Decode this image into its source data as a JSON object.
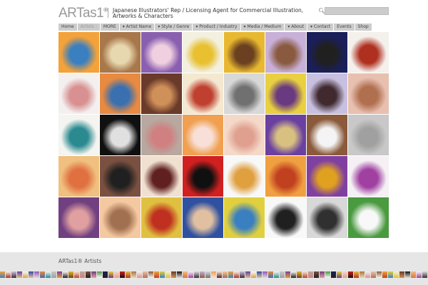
{
  "header": {
    "logo": "ARTas1",
    "logo_mark": "®",
    "tagline": "Japanese Illustrators' Rep / Licensing Agent for Commercial Illustration, Artworks & Characters",
    "search_placeholder": ""
  },
  "nav": [
    {
      "label": "Home"
    },
    {
      "label": "Artists :",
      "dim": true
    },
    {
      "label": "MORE"
    },
    {
      "label": "▾ Artist Name"
    },
    {
      "label": "▾ Style / Genre"
    },
    {
      "label": "▾ Product / Industry"
    },
    {
      "label": "▾ Media / Medium"
    },
    {
      "label": "▾ About"
    },
    {
      "label": "▾ Contact"
    },
    {
      "label": "Events"
    },
    {
      "label": "Shop"
    }
  ],
  "tiles": [
    [
      "#f4a23a",
      "#3a7fc0"
    ],
    [
      "#a8774a",
      "#e8d8b0"
    ],
    [
      "#8a5fb0",
      "#f0d0e0"
    ],
    [
      "#f3f0e0",
      "#e8c030"
    ],
    [
      "#e8b830",
      "#6a4020"
    ],
    [
      "#c8b0d8",
      "#8a5a40"
    ],
    [
      "#1a1f5a",
      "#202020"
    ],
    [
      "#f4f0ec",
      "#b03020"
    ],
    [
      "#f4f0f0",
      "#d89090"
    ],
    [
      "#e88a40",
      "#3a70b0"
    ],
    [
      "#6a3a2a",
      "#d0905a"
    ],
    [
      "#f4e8d0",
      "#c04030"
    ],
    [
      "#d8d8d8",
      "#707070"
    ],
    [
      "#e8d040",
      "#6a3a80"
    ],
    [
      "#c8c0e0",
      "#402a30"
    ],
    [
      "#e8c0b0",
      "#b07050"
    ],
    [
      "#f4f4f0",
      "#2a8a90"
    ],
    [
      "#101010",
      "#e0e0e0"
    ],
    [
      "#b8a8a0",
      "#d08080"
    ],
    [
      "#f0a050",
      "#f8e0d8"
    ],
    [
      "#f4d8c8",
      "#e0a090"
    ],
    [
      "#6a40a0",
      "#d8c080"
    ],
    [
      "#8a5a3a",
      "#f4f4f4"
    ],
    [
      "#c8c8c8",
      "#a0a0a0"
    ],
    [
      "#f0c080",
      "#e07040"
    ],
    [
      "#7a5040",
      "#202020"
    ],
    [
      "#f0e0d0",
      "#602020"
    ],
    [
      "#d02020",
      "#101010"
    ],
    [
      "#f8f8f8",
      "#e0a040"
    ],
    [
      "#f0a040",
      "#c04020"
    ],
    [
      "#8040a0",
      "#e0a020"
    ],
    [
      "#f4f0f4",
      "#a040a0"
    ],
    [
      "#704080",
      "#e0a0a0"
    ],
    [
      "#f4c8a0",
      "#a07050"
    ],
    [
      "#e0c040",
      "#c03020"
    ],
    [
      "#3050a0",
      "#e0c0a0"
    ],
    [
      "#e0d040",
      "#3a80c0"
    ],
    [
      "#f8f8f8",
      "#202020"
    ],
    [
      "#d8d8d8",
      "#303030"
    ],
    [
      "#4a9a40",
      "#f8f8f8"
    ]
  ],
  "footer": {
    "title": "ARTas1® Artists"
  }
}
